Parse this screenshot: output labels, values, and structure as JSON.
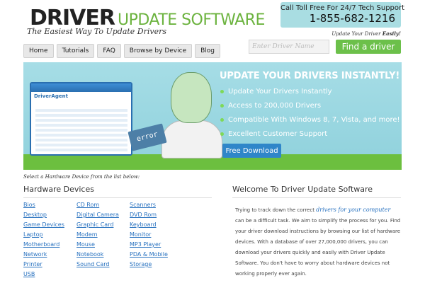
{
  "header": {
    "logo_driver": "DRIVER",
    "logo_update": "UPDATE SOFTWARE",
    "tagline": "The Easiest Way To Update Drivers",
    "call_label": "Call Toll Free For 24/7 Tech Support",
    "phone": "1-855-682-1216",
    "update_easily_prefix": "Update Your Driver ",
    "update_easily_emph": "Easily!"
  },
  "nav": [
    {
      "label": "Home"
    },
    {
      "label": "Tutorials"
    },
    {
      "label": "FAQ"
    },
    {
      "label": "Browse by Device"
    },
    {
      "label": "Blog"
    }
  ],
  "search": {
    "placeholder": "Enter Driver Name",
    "button_label": "Find a driver"
  },
  "banner": {
    "headline": "UPDATE YOUR DRIVERS INSTANTLY!",
    "bullets": [
      "Update Your Drivers Instantly",
      "Access to 200,000 Drivers",
      "Compatible With Windows 8, 7, Vista, and more!",
      "Excellent Customer Support"
    ],
    "cta": "Free Download",
    "app_brand": "DriverAgent",
    "laptop_text": "error"
  },
  "select_note": "Select a Hardware Device from the list below:",
  "hardware": {
    "title": "Hardware Devices",
    "columns": [
      [
        "Bios",
        "Desktop",
        "Game Devices",
        "Laptop",
        "Motherboard",
        "Network",
        "Printer",
        "USB"
      ],
      [
        "CD Rom",
        "Digital Camera",
        "Graphic Card",
        "Modem",
        "Mouse",
        "Notebook",
        "Sound Card"
      ],
      [
        "Scanners",
        "DVD Rom",
        "Keyboard",
        "Monitor",
        "MP3 Player",
        "PDA & Mobile",
        "Storage"
      ]
    ]
  },
  "welcome": {
    "title": "Welcome To Driver Update Software",
    "text_before": "Trying to track down the correct ",
    "link": "drivers for your computer",
    "text_after": " can be a difficult task. We aim to simplify the process for you. Find your driver download instructions by browsing our list of hardware devices. With a database of over 27,000,000 drivers, you can download your drivers quickly and easily with Driver Update Software. You don't have to worry about hardware devices not working properly ever again."
  },
  "colors": {
    "accent_green": "#6cb33f",
    "banner_blue": "#a6dde6",
    "link_blue": "#2a73c0",
    "cta_blue": "#2f86c9"
  }
}
